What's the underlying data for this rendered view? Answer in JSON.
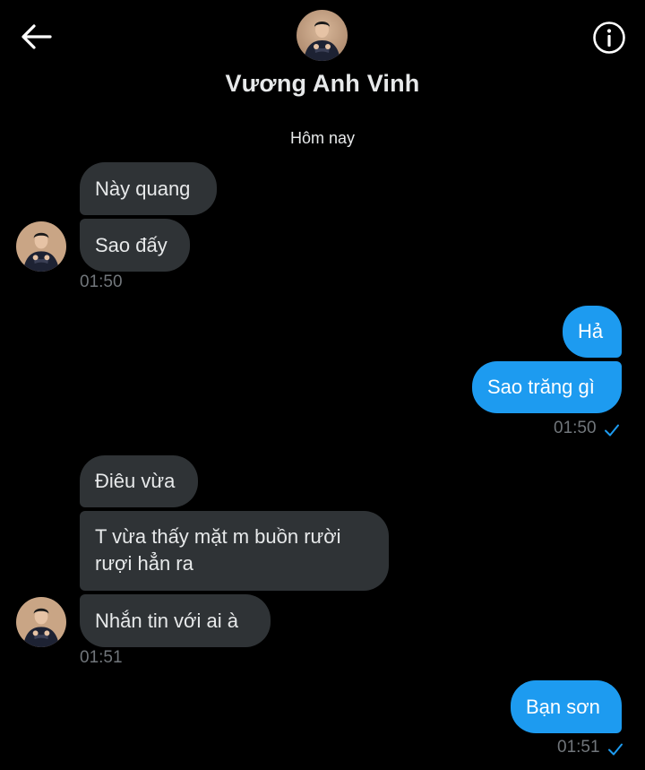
{
  "header": {
    "back_icon": "arrow-left-icon",
    "info_icon": "info-circle-icon",
    "contact_name": "Vương Anh Vinh"
  },
  "conversation": {
    "date_separator": "Hôm nay",
    "groups": [
      {
        "direction": "incoming",
        "messages": [
          "Này quang",
          "Sao đấy"
        ],
        "time": "01:50"
      },
      {
        "direction": "outgoing",
        "messages": [
          "Hả",
          "Sao trăng gì"
        ],
        "time": "01:50",
        "status_icon": "check-icon"
      },
      {
        "direction": "incoming",
        "messages": [
          "Điêu vừa",
          "T vừa thấy mặt m buồn rười rượi hẳn ra",
          "Nhắn tin với ai à"
        ],
        "time": "01:51"
      },
      {
        "direction": "outgoing",
        "messages": [
          "Bạn sơn"
        ],
        "time": "01:51",
        "status_icon": "check-icon"
      }
    ]
  },
  "colors": {
    "background": "#000000",
    "incoming_bubble": "#2f3336",
    "outgoing_bubble": "#1d9bf0",
    "timestamp": "#71767b",
    "check": "#1d9bf0"
  }
}
